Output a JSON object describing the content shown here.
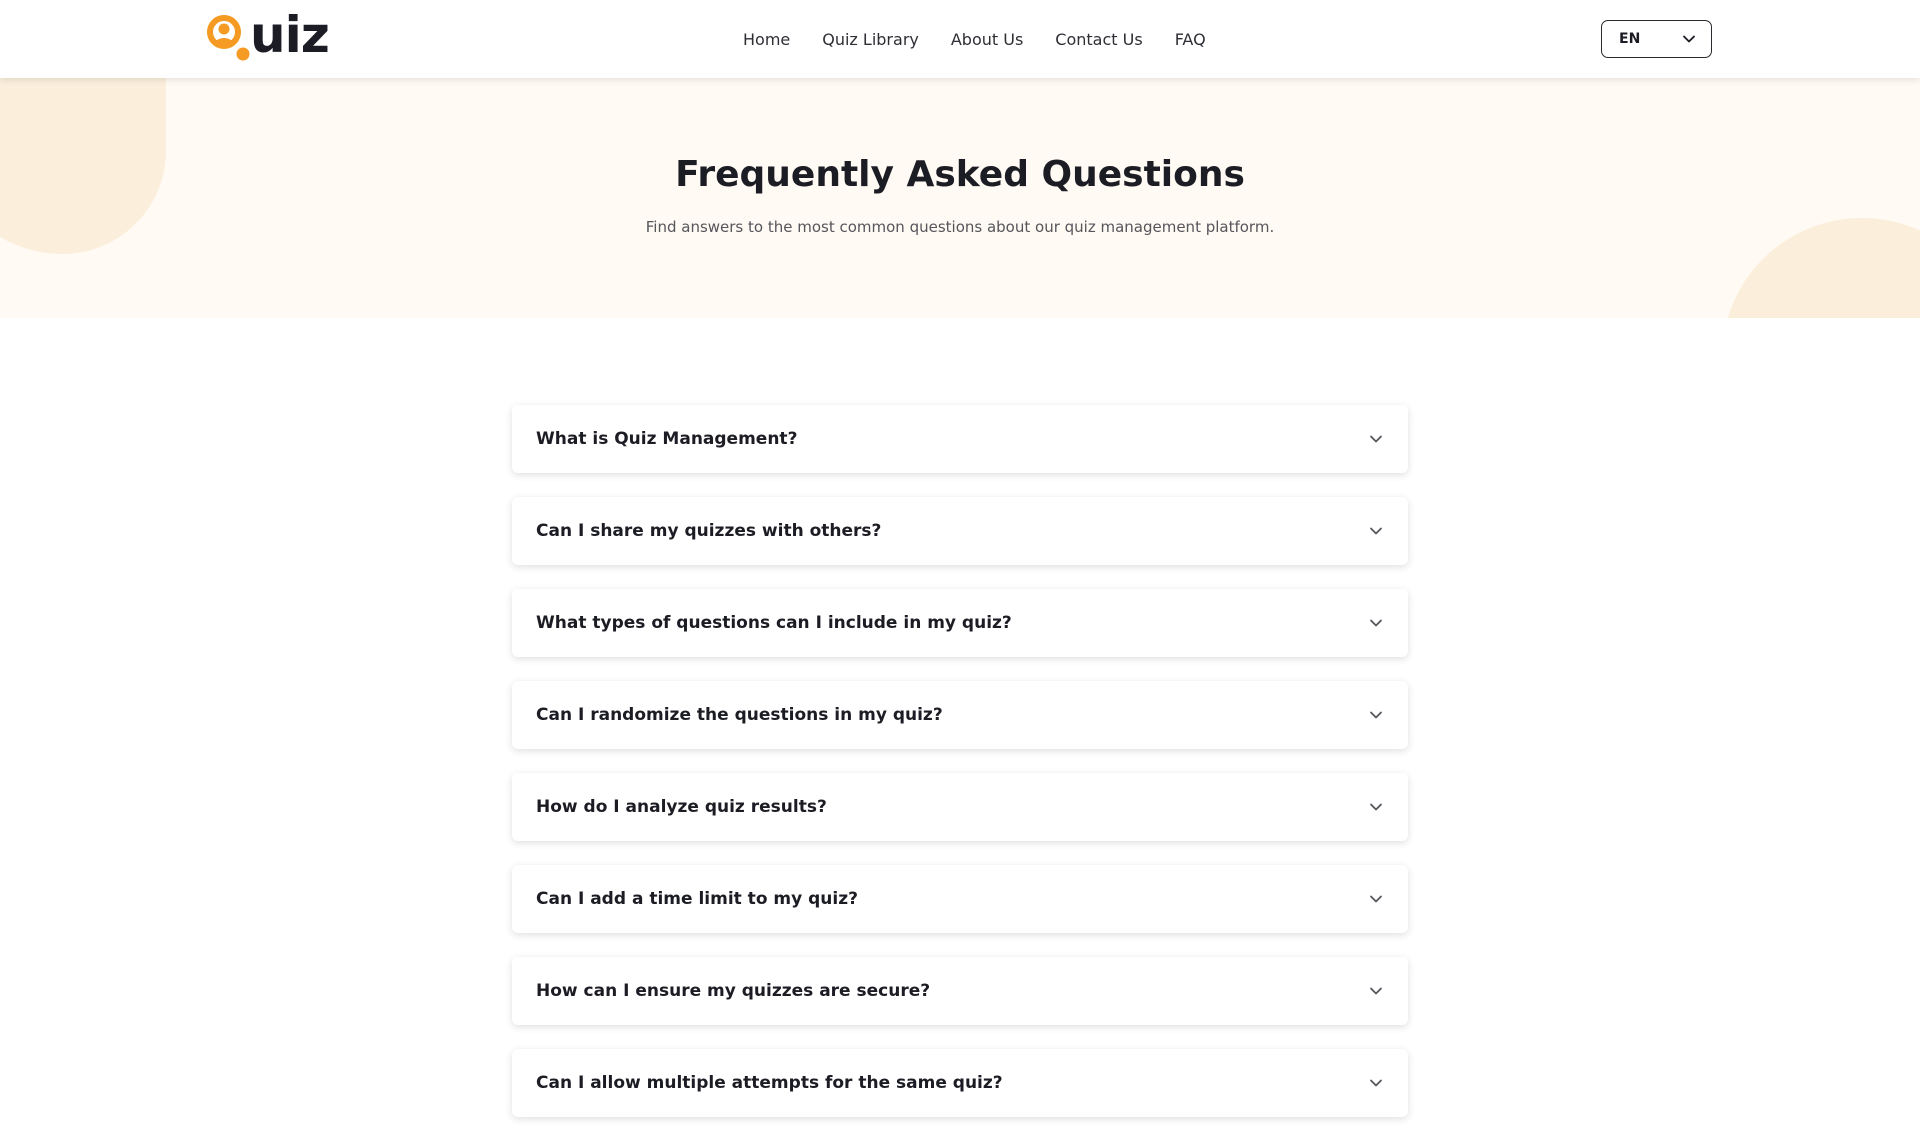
{
  "header": {
    "logo_text": "uiz",
    "logo_alt": "Quiz",
    "nav": [
      {
        "label": "Home"
      },
      {
        "label": "Quiz Library"
      },
      {
        "label": "About Us"
      },
      {
        "label": "Contact Us"
      },
      {
        "label": "FAQ"
      }
    ],
    "language": {
      "selected": "EN"
    }
  },
  "hero": {
    "title": "Frequently Asked Questions",
    "subtitle": "Find answers to the most common questions about our quiz management platform."
  },
  "faq": {
    "items": [
      {
        "question": "What is Quiz Management?"
      },
      {
        "question": "Can I share my quizzes with others?"
      },
      {
        "question": "What types of questions can I include in my quiz?"
      },
      {
        "question": "Can I randomize the questions in my quiz?"
      },
      {
        "question": "How do I analyze quiz results?"
      },
      {
        "question": "Can I add a time limit to my quiz?"
      },
      {
        "question": "How can I ensure my quizzes are secure?"
      },
      {
        "question": "Can I allow multiple attempts for the same quiz?"
      }
    ]
  },
  "colors": {
    "accent": "#f59a23",
    "hero_background": "#fffaf3",
    "blob": "#fbeedb",
    "text_dark": "#1c1c24"
  },
  "icons": {
    "logo": "quiz-logo-icon",
    "language_dropdown": "chevron-down-icon",
    "faq_toggle": "chevron-down-icon"
  }
}
